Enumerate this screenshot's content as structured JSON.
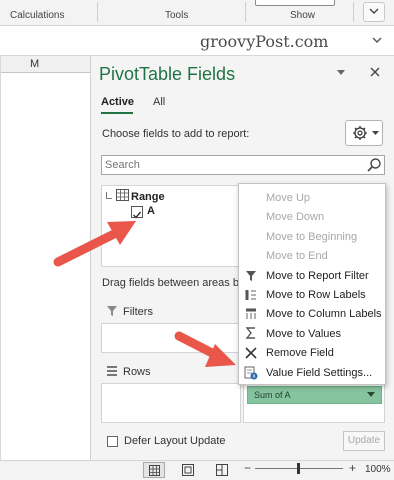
{
  "ribbon": {
    "groups": [
      "Calculations",
      "Tools",
      "Show"
    ],
    "expand_icon": "chevron-down-icon"
  },
  "watermark": "groovyPost.com",
  "sheet": {
    "column_header": "M"
  },
  "pane": {
    "title": "PivotTable Fields",
    "tabs": [
      {
        "label": "Active",
        "selected": true
      },
      {
        "label": "All",
        "selected": false
      }
    ],
    "choose_text": "Choose fields to add to report:",
    "search_placeholder": "Search",
    "tables": [
      {
        "name": "Range",
        "fields": [
          {
            "label": "A",
            "checked": true
          }
        ]
      }
    ],
    "drag_text": "Drag fields between areas below:",
    "areas": {
      "filters": "Filters",
      "rows": "Rows",
      "values_chip": "Sum of A"
    },
    "defer_label": "Defer Layout Update",
    "update_label": "Update"
  },
  "context_menu": {
    "items": [
      {
        "label": "Move Up",
        "enabled": false,
        "icon": null
      },
      {
        "label": "Move Down",
        "enabled": false,
        "icon": null
      },
      {
        "label": "Move to Beginning",
        "enabled": false,
        "icon": null
      },
      {
        "label": "Move to End",
        "enabled": false,
        "icon": null
      },
      {
        "label": "Move to Report Filter",
        "enabled": true,
        "icon": "filter-icon"
      },
      {
        "label": "Move to Row Labels",
        "enabled": true,
        "icon": "rows-icon"
      },
      {
        "label": "Move to Column Labels",
        "enabled": true,
        "icon": "columns-icon"
      },
      {
        "label": "Move to Values",
        "enabled": true,
        "icon": "sigma-icon"
      },
      {
        "label": "Remove Field",
        "enabled": true,
        "icon": "remove-icon"
      },
      {
        "label": "Value Field Settings...",
        "enabled": true,
        "icon": "value-settings-icon"
      }
    ]
  },
  "status_bar": {
    "zoom_level": "100%",
    "zoom_minus": "−",
    "zoom_plus": "+",
    "views": [
      "normal-view-icon",
      "page-layout-icon",
      "page-break-icon"
    ]
  },
  "colors": {
    "accent": "#217346",
    "chip": "#86c49f",
    "annotation_arrow": "#e8574a"
  }
}
